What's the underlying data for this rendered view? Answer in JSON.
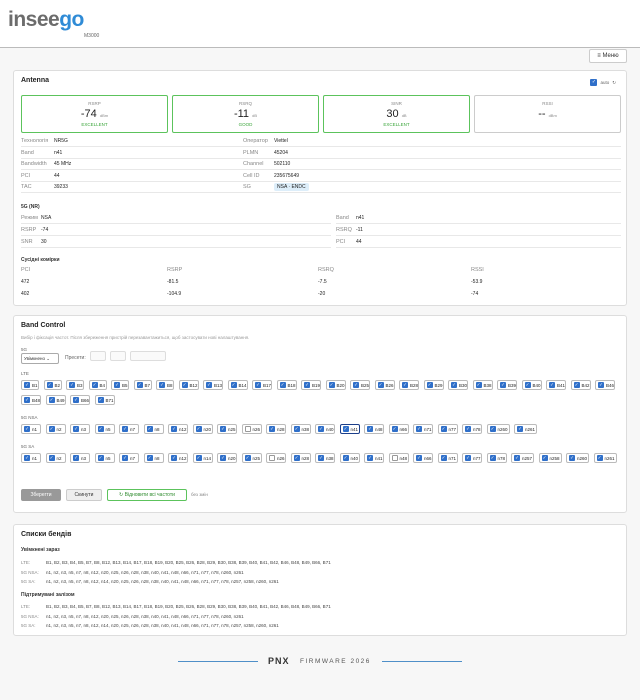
{
  "header": {
    "logo_part1": "insee",
    "logo_part2": "go",
    "model": "M3000",
    "menu_label": "≡ Меню"
  },
  "antenna": {
    "title": "Antenna",
    "auto_label": "auto",
    "metrics": [
      {
        "name": "RSRP",
        "value": "-74",
        "unit": "dBm",
        "quality": "EXCELLENT"
      },
      {
        "name": "RSRQ",
        "value": "-11",
        "unit": "dB",
        "quality": "GOOD"
      },
      {
        "name": "SINR",
        "value": "30",
        "unit": "dB",
        "quality": "EXCELLENT"
      },
      {
        "name": "RSSI",
        "value": "--",
        "unit": "dBm",
        "quality": ""
      }
    ],
    "info_left": [
      {
        "k": "Технологія",
        "v": "NR5G"
      },
      {
        "k": "Band",
        "v": "n41"
      },
      {
        "k": "Bandwidth",
        "v": "45 MHz"
      },
      {
        "k": "PCI",
        "v": "44"
      },
      {
        "k": "TAC",
        "v": "39233"
      }
    ],
    "info_right": [
      {
        "k": "Оператор",
        "v": "Viettel"
      },
      {
        "k": "PLMN",
        "v": "45204"
      },
      {
        "k": "Channel",
        "v": "502110"
      },
      {
        "k": "Cell ID",
        "v": "23567564​9"
      },
      {
        "k": "SG",
        "v": "NSA · ENDC"
      }
    ],
    "nr_title": "5G (NR)",
    "nr_left": [
      {
        "k": "Режим",
        "v": "NSA"
      },
      {
        "k": "RSRP",
        "v": "-74"
      },
      {
        "k": "SNR",
        "v": "30"
      }
    ],
    "nr_right": [
      {
        "k": "Band",
        "v": "n41"
      },
      {
        "k": "RSRQ",
        "v": "-11"
      },
      {
        "k": "PCI",
        "v": "44"
      }
    ],
    "neighbors_title": "Сусідні комірки",
    "neighbors_headers": [
      "PCI",
      "RSRP",
      "RSRQ",
      "RSSI"
    ],
    "neighbors_rows": [
      [
        "472",
        "-81.5",
        "-7.5",
        "-53.9"
      ],
      [
        "402",
        "-104.9",
        "-20",
        "-74"
      ]
    ]
  },
  "band_control": {
    "title": "Band Control",
    "hint": "Вибір і фіксація частот. Після збереження пристрій перезавантажиться, щоб застосувати нові налаштування.",
    "fiveg_label": "5G",
    "mode_value": "Увімкнено ⌄",
    "presets_label": "Пресети:",
    "lte_label": "LTE",
    "lte_bands": [
      "B1",
      "B2",
      "B3",
      "B4",
      "B5",
      "B7",
      "B8",
      "B12",
      "B13",
      "B14",
      "B17",
      "B18",
      "B19",
      "B20",
      "B25",
      "B26",
      "B28",
      "B29",
      "B30",
      "B38",
      "B39",
      "B40",
      "B41",
      "B42",
      "B46",
      "B48",
      "B49",
      "B66",
      "B71"
    ],
    "nsa_label": "5G NSA",
    "nsa_bands": [
      "n1",
      "n2",
      "n3",
      "n5",
      "n7",
      "n8",
      "n12",
      "n20",
      "n25",
      "n26",
      "n28",
      "n38",
      "n40",
      "n41",
      "n48",
      "n66",
      "n71",
      "n77",
      "n78",
      "n260",
      "n261"
    ],
    "sa_label": "5G SA",
    "sa_bands": [
      "n1",
      "n2",
      "n3",
      "n5",
      "n7",
      "n8",
      "n12",
      "n14",
      "n20",
      "n25",
      "n26",
      "n28",
      "n38",
      "n40",
      "n41",
      "n48",
      "n66",
      "n71",
      "n77",
      "n78",
      "n257",
      "n258",
      "n260",
      "n261"
    ],
    "save_label": "Зберегти",
    "reset_label": "Скинути",
    "restore_label": "↻ Відновити всі частоти",
    "no_changes": "без змін"
  },
  "band_lists": {
    "title": "Списки бендів",
    "enabled_title": "Увімкнені зараз",
    "supported_title": "Підтримувані залізом",
    "enabled": [
      {
        "k": "LTE:",
        "v": "B1, B2, B3, B4, B5, B7, B8, B12, B13, B14, B17, B18, B19, B20, B25, B26, B28, B29, B30, B38, B39, B40, B41, B42, B46, B48, B49, B66, B71"
      },
      {
        "k": "5G NSA:",
        "v": "n1, n2, n3, n5, n7, n8, n12, n20, n25, n26, n28, n38, n40, n41, n48, n66, n71, n77, n78, n260, n261"
      },
      {
        "k": "5G SA:",
        "v": "n1, n2, n3, n5, n7, n8, n12, n14, n20, n25, n26, n28, n38, n40, n41, n48, n66, n71, n77, n78, n257, n258, n260, n261"
      }
    ],
    "supported": [
      {
        "k": "LTE:",
        "v": "B1, B2, B3, B4, B5, B7, B8, B12, B13, B14, B17, B18, B19, B20, B25, B26, B28, B29, B30, B38, B39, B40, B41, B42, B46, B48, B49, B66, B71"
      },
      {
        "k": "5G NSA:",
        "v": "n1, n2, n3, n5, n7, n8, n12, n20, n25, n26, n28, n38, n40, n41, n48, n66, n71, n77, n78, n260, n261"
      },
      {
        "k": "5G SA:",
        "v": "n1, n2, n3, n5, n7, n8, n12, n14, n20, n25, n26, n28, n38, n40, n41, n48, n66, n71, n77, n78, n257, n258, n260, n261"
      }
    ]
  },
  "footer": {
    "brand": "PNX",
    "firmware": "FIRMWARE 2026"
  }
}
